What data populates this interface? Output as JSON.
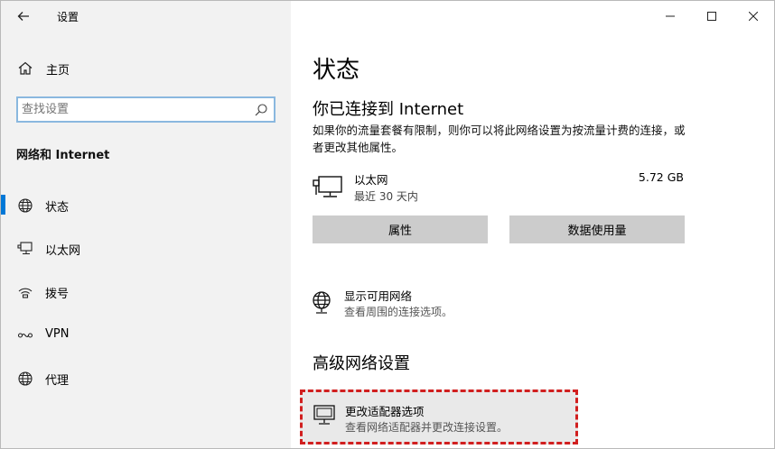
{
  "window": {
    "title": "设置"
  },
  "sidebar": {
    "home_label": "主页",
    "search_placeholder": "查找设置",
    "section_title": "网络和 Internet",
    "items": [
      {
        "label": "状态",
        "icon": "globe-icon",
        "active": true
      },
      {
        "label": "以太网",
        "icon": "ethernet-icon",
        "active": false
      },
      {
        "label": "拨号",
        "icon": "dialup-icon",
        "active": false
      },
      {
        "label": "VPN",
        "icon": "vpn-icon",
        "active": false
      },
      {
        "label": "代理",
        "icon": "globe-icon",
        "active": false
      }
    ]
  },
  "main": {
    "title": "状态",
    "connection_title": "你已连接到 Internet",
    "connection_desc": "如果你的流量套餐有限制，则你可以将此网络设置为按流量计费的连接，或者更改其他属性。",
    "ethernet": {
      "name": "以太网",
      "sub": "最近 30 天内",
      "size": "5.72 GB"
    },
    "buttons": {
      "properties": "属性",
      "data_usage": "数据使用量"
    },
    "show_networks": {
      "title": "显示可用网络",
      "sub": "查看周围的连接选项。"
    },
    "advanced_title": "高级网络设置",
    "adapter_options": {
      "title": "更改适配器选项",
      "sub": "查看网络适配器并更改连接设置。"
    }
  },
  "colors": {
    "accent": "#0078d7",
    "highlight_border": "#d11f1f",
    "sidebar_bg": "#f2f2f2",
    "button_bg": "#cccccc"
  }
}
